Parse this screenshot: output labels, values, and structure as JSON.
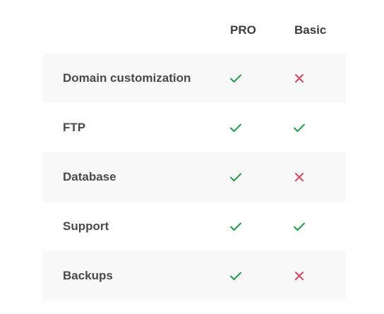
{
  "table": {
    "columns": [
      "PRO",
      "Basic"
    ],
    "rows": [
      {
        "feature": "Domain customization",
        "pro": "check",
        "basic": "cross"
      },
      {
        "feature": "FTP",
        "pro": "check",
        "basic": "check"
      },
      {
        "feature": "Database",
        "pro": "check",
        "basic": "cross"
      },
      {
        "feature": "Support",
        "pro": "check",
        "basic": "check"
      },
      {
        "feature": "Backups",
        "pro": "check",
        "basic": "cross"
      }
    ]
  },
  "colors": {
    "check": "#1e9e4a",
    "cross": "#d9465f",
    "row_shade": "#f8f8f8",
    "text": "#3d3d3d"
  },
  "icons": {
    "check": "check-icon",
    "cross": "cross-icon"
  }
}
